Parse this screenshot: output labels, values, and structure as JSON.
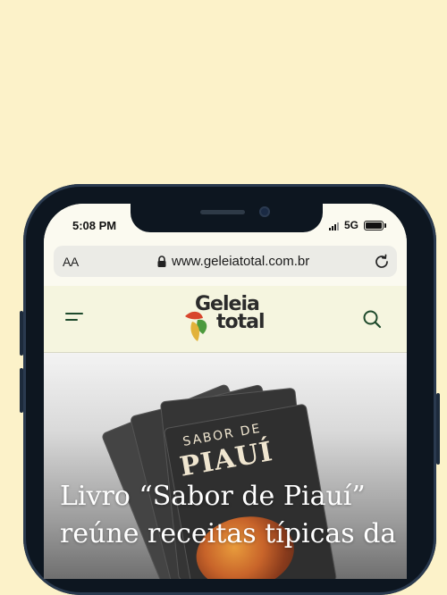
{
  "status_bar": {
    "time": "5:08 PM",
    "network": "5G"
  },
  "browser": {
    "text_size_label": "AA",
    "url": "www.geleiatotal.com.br"
  },
  "site_header": {
    "logo_line1": "Geleia",
    "logo_line2": "total"
  },
  "article": {
    "book_title_line1": "SABOR DE",
    "book_title_line2": "PIAUÍ",
    "headline": "Livro “Sabor de Piauí” reúne receitas típicas da"
  },
  "colors": {
    "page_background": "#fcf2c9",
    "site_accent": "#1e4a2c",
    "logo_red": "#d8452c",
    "logo_yellow": "#e2b23a",
    "logo_green": "#4c9a3d"
  },
  "icons": [
    "lock-icon",
    "reload-icon",
    "menu-icon",
    "search-icon",
    "signal-icon",
    "battery-icon"
  ]
}
